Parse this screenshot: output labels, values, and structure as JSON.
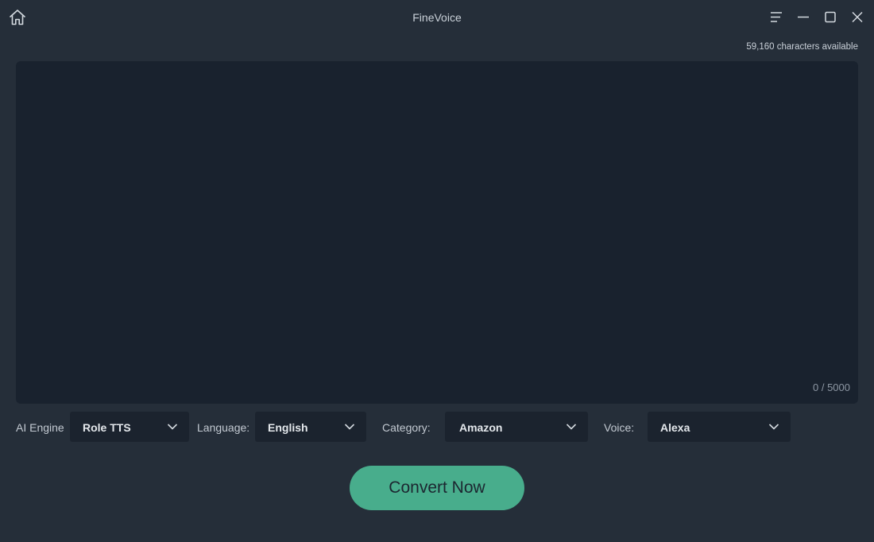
{
  "window": {
    "title": "FineVoice"
  },
  "header": {
    "characters_available": "59,160 characters available"
  },
  "editor": {
    "text": "",
    "counter": "0 / 5000"
  },
  "options": {
    "ai_engine": {
      "label": "AI Engine",
      "value": "Role TTS"
    },
    "language": {
      "label": "Language:",
      "value": "English"
    },
    "category": {
      "label": "Category:",
      "value": "Amazon"
    },
    "voice": {
      "label": "Voice:",
      "value": "Alexa"
    }
  },
  "actions": {
    "convert_label": "Convert Now"
  },
  "colors": {
    "background": "#252e39",
    "editor_bg": "#19222e",
    "select_bg": "#1b232e",
    "accent": "#48ad8c"
  },
  "icons": [
    "home-icon",
    "menu-icon",
    "minimize-icon",
    "maximize-icon",
    "close-icon",
    "chevron-down-icon"
  ]
}
